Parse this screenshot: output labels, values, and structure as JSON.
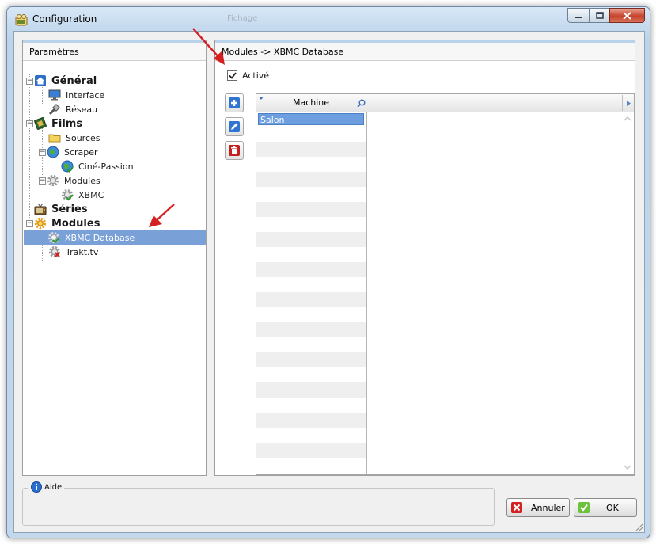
{
  "window": {
    "title": "Configuration",
    "faded_title": "Fichage"
  },
  "left_panel": {
    "header": "Paramètres",
    "tree": [
      {
        "label": "Général",
        "icon": "home-icon"
      },
      {
        "label": "Interface",
        "icon": "monitor-icon"
      },
      {
        "label": "Réseau",
        "icon": "network-plug-icon"
      },
      {
        "label": "Films",
        "icon": "film-icon"
      },
      {
        "label": "Sources",
        "icon": "folder-icon"
      },
      {
        "label": "Scraper",
        "icon": "globe-icon"
      },
      {
        "label": "Ciné-Passion",
        "icon": "globe-check-icon"
      },
      {
        "label": "Modules",
        "icon": "gear-icon"
      },
      {
        "label": "XBMC",
        "icon": "gear-check-icon"
      },
      {
        "label": "Séries",
        "icon": "tv-icon"
      },
      {
        "label": "Modules",
        "icon": "gears-icon"
      },
      {
        "label": "XBMC Database",
        "icon": "gear-check-icon",
        "selected": true
      },
      {
        "label": "Trakt.tv",
        "icon": "gear-error-icon"
      }
    ]
  },
  "right_panel": {
    "header": "Modules -> XBMC Database",
    "active_label": "Activé",
    "active_checked": true,
    "grid": {
      "column": "Machine",
      "rows": [
        "Salon"
      ]
    }
  },
  "help": {
    "label": "Aide"
  },
  "buttons": {
    "cancel": "Annuler",
    "ok": "OK"
  },
  "colors": {
    "selection": "#7aa0d8",
    "accent": "#2a6fd0",
    "arrow": "#d42020"
  }
}
